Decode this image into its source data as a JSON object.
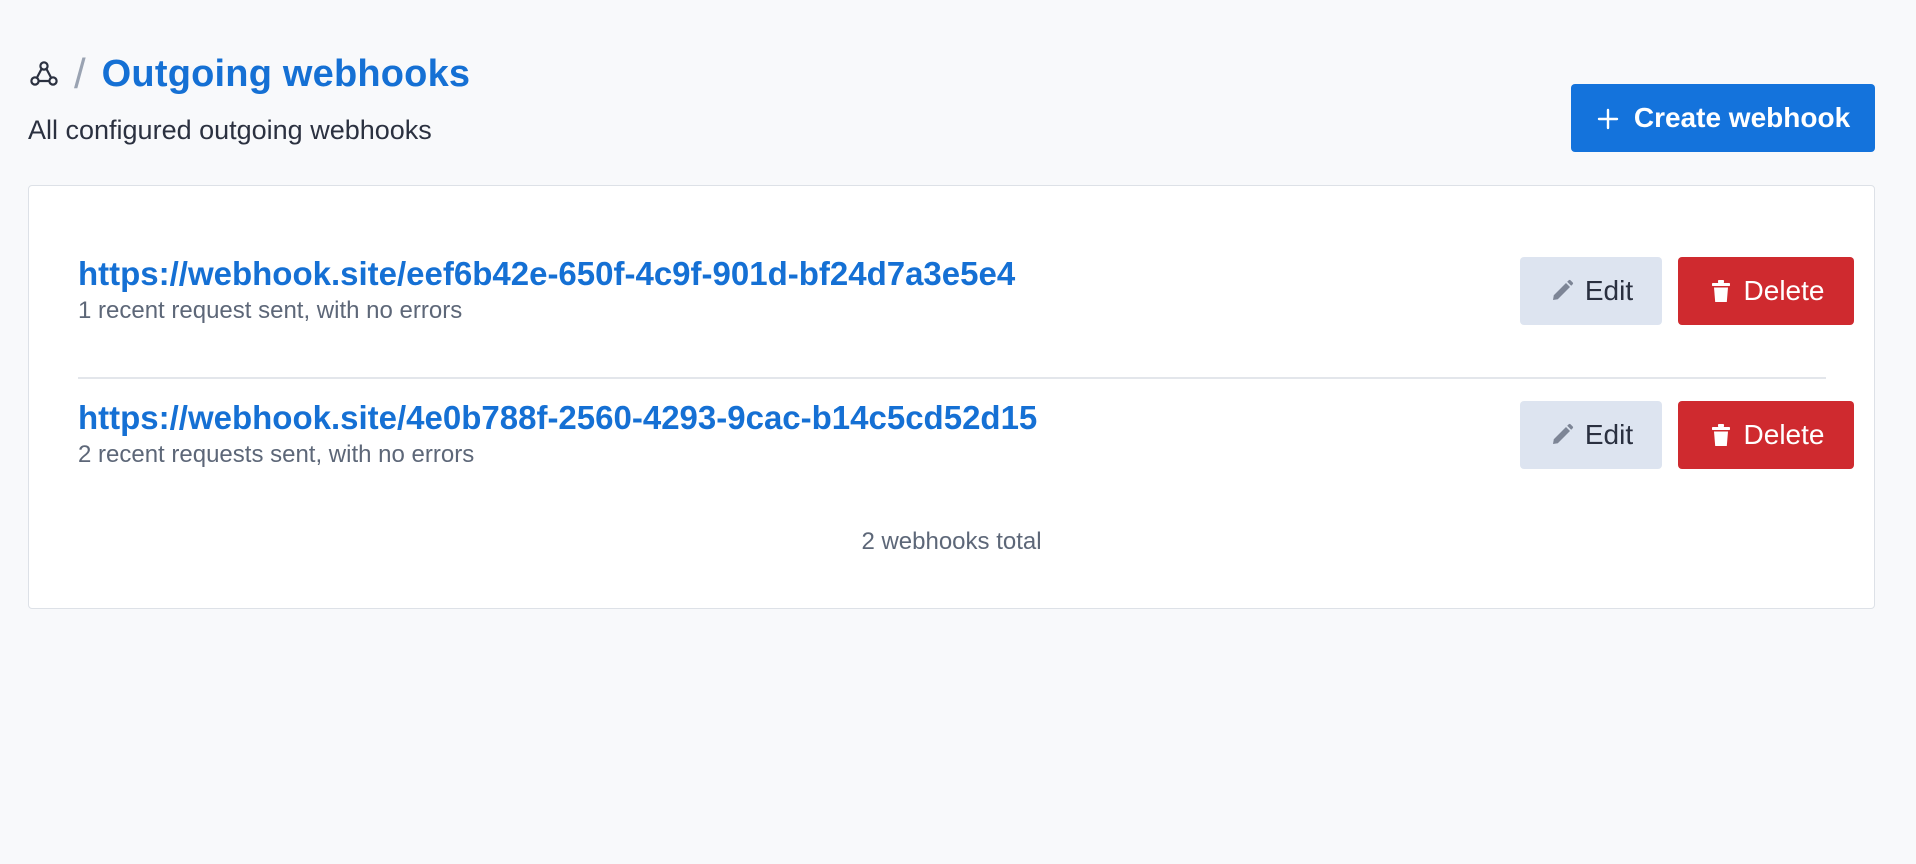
{
  "header": {
    "separator": "/",
    "title": "Outgoing webhooks",
    "subtitle": "All configured outgoing webhooks",
    "create_label": "Create webhook"
  },
  "webhooks": [
    {
      "url": "https://webhook.site/eef6b42e-650f-4c9f-901d-bf24d7a3e5e4",
      "status": "1 recent request sent, with no errors",
      "edit_label": "Edit",
      "delete_label": "Delete"
    },
    {
      "url": "https://webhook.site/4e0b788f-2560-4293-9cac-b14c5cd52d15",
      "status": "2 recent requests sent, with no errors",
      "edit_label": "Edit",
      "delete_label": "Delete"
    }
  ],
  "footer": {
    "total": "2 webhooks total"
  },
  "icons": {
    "breadcrumb": "webhook-icon",
    "create": "plus-icon",
    "edit": "pencil-icon",
    "delete": "trash-icon"
  },
  "colors": {
    "primary": "#1473dc",
    "link": "#1570d4",
    "danger": "#cf2a2f",
    "secondary_bg": "#dde4f0",
    "background": "#f8f9fb"
  }
}
